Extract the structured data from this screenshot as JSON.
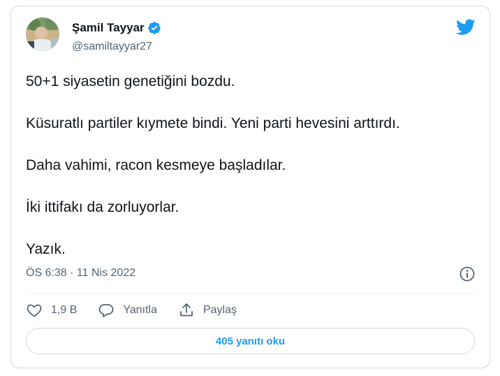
{
  "author": {
    "name": "Şamil Tayyar",
    "handle": "@samiltayyar27",
    "avatar_icon": "avatar-photo"
  },
  "tweet": {
    "lines": [
      "50+1 siyasetin genetiğini bozdu.",
      "Küsuratlı partiler kıymete bindi. Yeni parti hevesini arttırdı.",
      "Daha vahimi, racon kesmeye başladılar.",
      "İki ittifakı da zorluyorlar.",
      "Yazık."
    ],
    "timestamp": "ÖS 6:38 · 11 Nis 2022"
  },
  "actions": {
    "like_count": "1,9 B",
    "reply_label": "Yanıtla",
    "share_label": "Paylaş"
  },
  "read_replies_label": "405 yanıtı oku",
  "colors": {
    "brand": "#1d9bf0",
    "text": "#0f1419",
    "secondary": "#536471",
    "border": "#cfd9de"
  },
  "icons": [
    "verified-badge-icon",
    "twitter-bird-icon",
    "info-icon",
    "heart-icon",
    "reply-bubble-icon",
    "share-icon"
  ]
}
